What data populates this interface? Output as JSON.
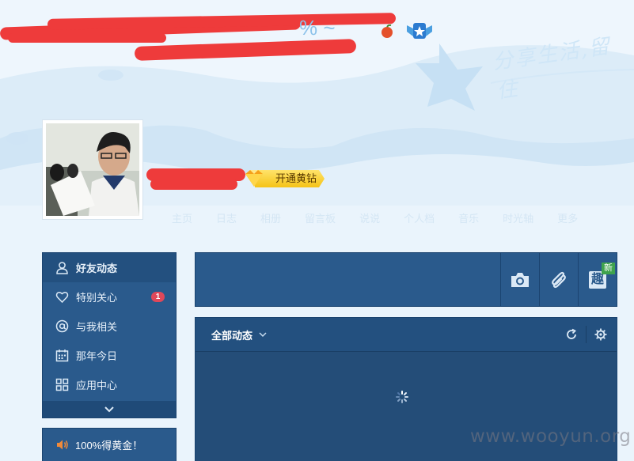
{
  "header": {
    "glyphs": "% ~",
    "slogan": "分享生活,留住",
    "vip_button_label": "开通黄钻"
  },
  "nav": {
    "items": [
      "主页",
      "日志",
      "相册",
      "留言板",
      "说说",
      "个人档",
      "音乐",
      "时光轴",
      "更多"
    ]
  },
  "sidebar": {
    "items": [
      {
        "label": "好友动态",
        "icon": "person-icon"
      },
      {
        "label": "特别关心",
        "icon": "heart-icon",
        "badge": "1"
      },
      {
        "label": "与我相关",
        "icon": "at-icon"
      },
      {
        "label": "那年今日",
        "icon": "calendar-icon"
      },
      {
        "label": "应用中心",
        "icon": "apps-grid-icon"
      }
    ]
  },
  "promo": {
    "label": "100%得黄金！"
  },
  "composer": {
    "new_tag": "新",
    "fun_label": "趣"
  },
  "feed": {
    "filter_label": "全部动态"
  },
  "watermark": "www.wooyun.org",
  "colors": {
    "panel": "#2a5a8c",
    "panel_dark": "#244d78",
    "badge_red": "#e0485a",
    "vip_gold": "#f5c316",
    "new_green": "#3fa34d"
  }
}
